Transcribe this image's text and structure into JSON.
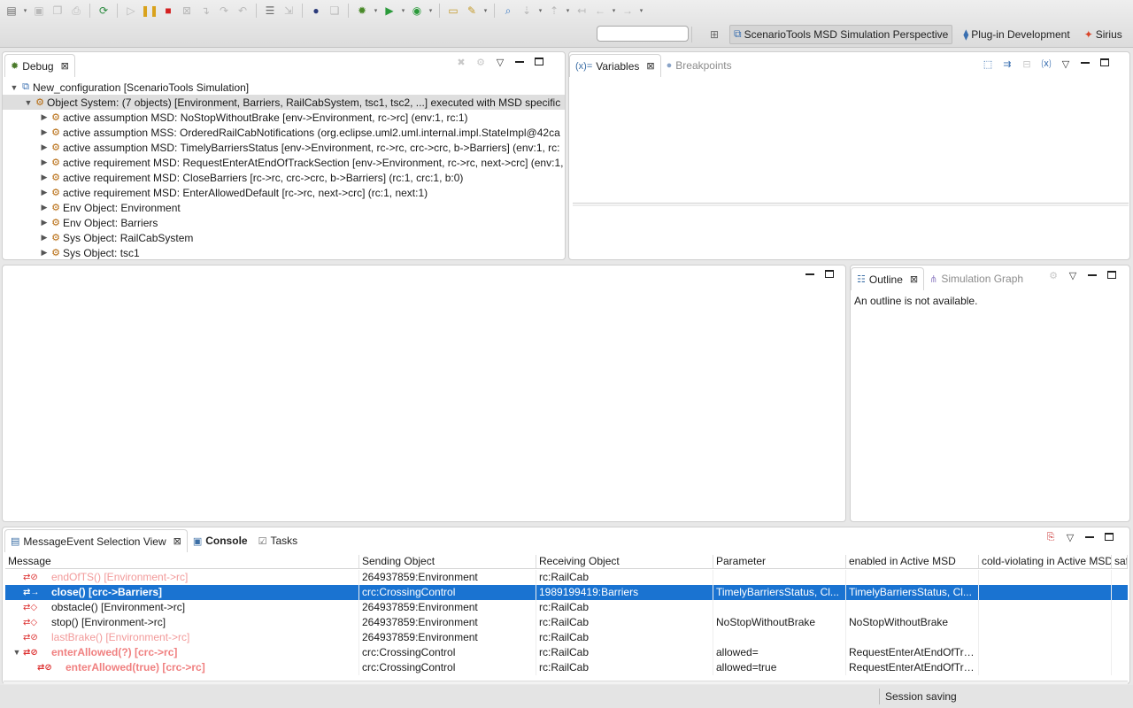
{
  "toolbar": {
    "quick_access_placeholder": "",
    "perspectives": [
      {
        "label": "ScenarioTools MSD Simulation Perspective",
        "icon": "perspective-icon",
        "active": true
      },
      {
        "label": "Plug-in Development",
        "icon": "plugin-icon",
        "active": false
      },
      {
        "label": "Sirius",
        "icon": "sirius-icon",
        "active": false
      }
    ]
  },
  "debug": {
    "tab_label": "Debug",
    "rows": [
      {
        "label": "New_configuration [ScenarioTools Simulation]",
        "level": 0
      },
      {
        "label": "Object System: (7 objects) [Environment, Barriers, RailCabSystem, tsc1, tsc2, ...] executed with MSD specific",
        "level": 1
      },
      {
        "label": "active assumption MSD: NoStopWithoutBrake [env->Environment, rc->rc] (env:1, rc:1)",
        "level": 2
      },
      {
        "label": "active assumption MSS: OrderedRailCabNotifications  (org.eclipse.uml2.uml.internal.impl.StateImpl@42ca",
        "level": 2
      },
      {
        "label": "active assumption MSD: TimelyBarriersStatus [env->Environment, rc->rc, crc->crc, b->Barriers] (env:1, rc:",
        "level": 2
      },
      {
        "label": "active requirement MSD: RequestEnterAtEndOfTrackSection [env->Environment, rc->rc, next->crc] (env:1,",
        "level": 2
      },
      {
        "label": "active requirement MSD: CloseBarriers [rc->rc, crc->crc, b->Barriers] (rc:1, crc:1, b:0)",
        "level": 2
      },
      {
        "label": "active requirement MSD: EnterAllowedDefault [rc->rc, next->crc] (rc:1, next:1)",
        "level": 2
      },
      {
        "label": "Env Object: Environment",
        "level": 2
      },
      {
        "label": "Env Object: Barriers",
        "level": 2
      },
      {
        "label": "Sys Object: RailCabSystem",
        "level": 2
      },
      {
        "label": "Sys Object: tsc1",
        "level": 2
      }
    ]
  },
  "variables": {
    "tab_label": "Variables",
    "breakpoints_label": "Breakpoints"
  },
  "outline": {
    "tab_label": "Outline",
    "graph_label": "Simulation Graph",
    "message": "An outline is not available."
  },
  "bottom": {
    "tabs": [
      "MessageEvent Selection View",
      "Console",
      "Tasks"
    ],
    "columns": [
      "Message",
      "Sending Object",
      "Receiving Object",
      "Parameter",
      "enabled in Active MSD",
      "cold-violating in Active MSD",
      "saf"
    ],
    "rows": [
      {
        "message": "endOfTS() [Environment->rc]",
        "style": "red",
        "sending": "264937859:Environment",
        "receiving": "rc:RailCab",
        "parameter": "",
        "enabled": "",
        "cold": ""
      },
      {
        "message": "close() [crc->Barriers]",
        "style": "selected",
        "sending": "crc:CrossingControl",
        "receiving": "1989199419:Barriers",
        "parameter": "TimelyBarriersStatus, Cl...",
        "enabled": "TimelyBarriersStatus, Cl...",
        "cold": ""
      },
      {
        "message": "obstacle() [Environment->rc]",
        "style": "normal",
        "sending": "264937859:Environment",
        "receiving": "rc:RailCab",
        "parameter": "",
        "enabled": "",
        "cold": ""
      },
      {
        "message": "stop() [Environment->rc]",
        "style": "normal",
        "sending": "264937859:Environment",
        "receiving": "rc:RailCab",
        "parameter": "NoStopWithoutBrake",
        "enabled": "NoStopWithoutBrake",
        "cold": ""
      },
      {
        "message": "lastBrake() [Environment->rc]",
        "style": "red",
        "sending": "264937859:Environment",
        "receiving": "rc:RailCab",
        "parameter": "",
        "enabled": "",
        "cold": ""
      },
      {
        "message": "enterAllowed(?) [crc->rc]",
        "style": "redbold",
        "sending": "crc:CrossingControl",
        "receiving": "rc:RailCab",
        "parameter": "allowed=",
        "enabled": "RequestEnterAtEndOfTra...",
        "cold": ""
      },
      {
        "message": "enterAllowed(true) [crc->rc]",
        "style": "redbold",
        "sending": "crc:CrossingControl",
        "receiving": "rc:RailCab",
        "parameter": "allowed=true",
        "enabled": "RequestEnterAtEndOfTra...",
        "cold": ""
      }
    ]
  },
  "status": {
    "text": "Session saving"
  }
}
